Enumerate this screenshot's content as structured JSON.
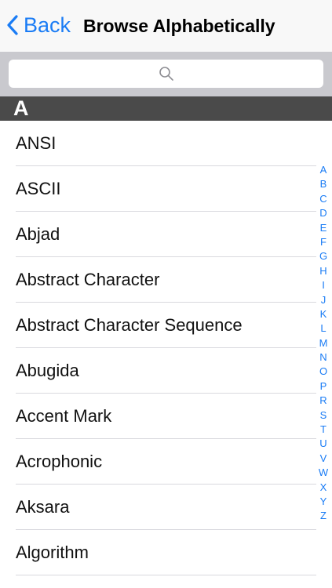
{
  "navbar": {
    "back_label": "Back",
    "title": "Browse Alphabetically"
  },
  "search": {
    "placeholder": ""
  },
  "section": {
    "letter": "A"
  },
  "items": [
    "ANSI",
    "ASCII",
    "Abjad",
    "Abstract Character",
    "Abstract Character Sequence",
    "Abugida",
    "Accent Mark",
    "Acrophonic",
    "Aksara",
    "Algorithm"
  ],
  "index_letters": [
    "A",
    "B",
    "C",
    "D",
    "E",
    "F",
    "G",
    "H",
    "I",
    "J",
    "K",
    "L",
    "M",
    "N",
    "O",
    "P",
    "R",
    "S",
    "T",
    "U",
    "V",
    "W",
    "X",
    "Y",
    "Z"
  ],
  "colors": {
    "accent": "#1a7cf5",
    "section_header": "#4a4a4a",
    "search_bar": "#c9c9ce"
  },
  "icons": {
    "back": "chevron-left-icon",
    "search": "magnifier-icon"
  }
}
